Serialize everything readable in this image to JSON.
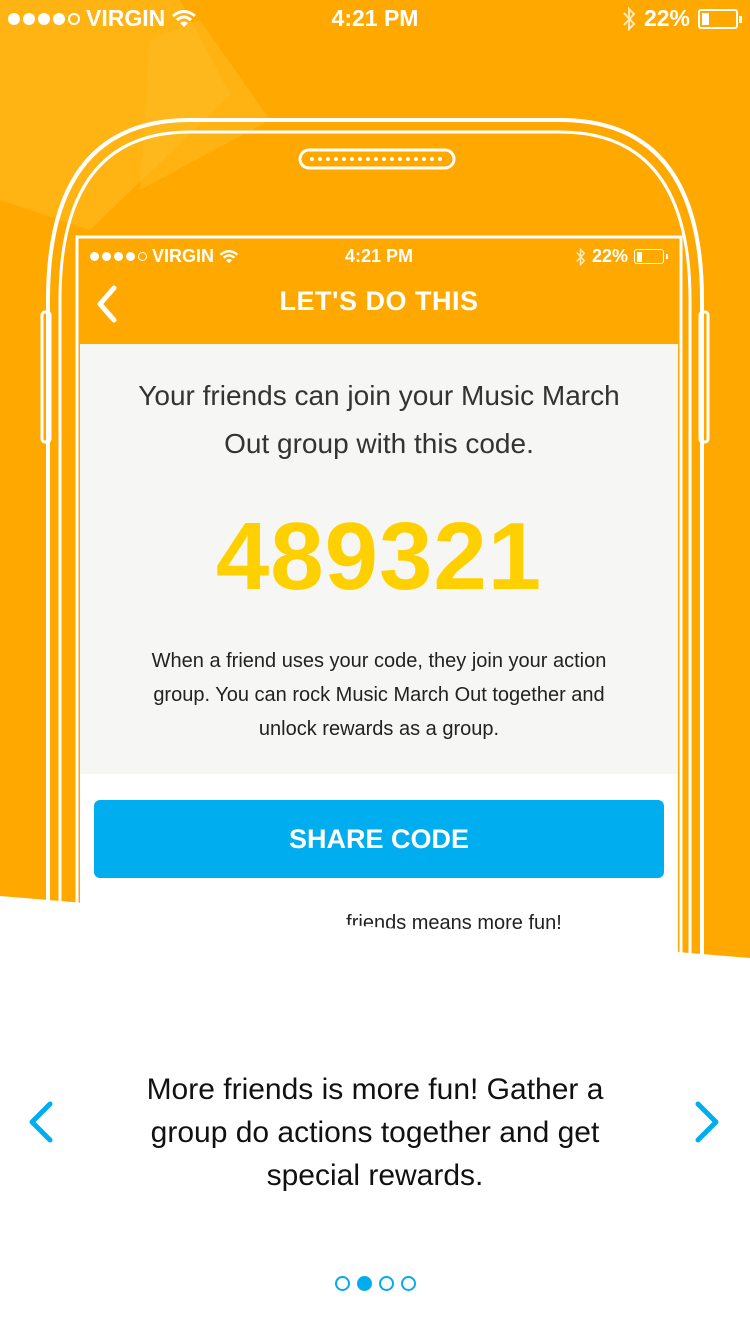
{
  "status_bar": {
    "carrier": "VIRGIN",
    "time": "4:21 PM",
    "battery": "22%"
  },
  "screen": {
    "status_bar": {
      "carrier": "VIRGIN",
      "time": "4:21 PM",
      "battery": "22%"
    },
    "title": "LET'S DO THIS",
    "intro": "Your friends can join your Music March Out group with this code.",
    "code": "489321",
    "explanation": "When a friend uses your code, they join your action group. You can rock Music March Out together and unlock rewards as a group.",
    "share_button": "SHARE CODE",
    "teaser": "friends means more fun!"
  },
  "carousel": {
    "caption": "More friends is more fun! Gather a group do actions together and get special rewards.",
    "page_count": 4,
    "active_page": 2
  },
  "colors": {
    "brand_orange": "#FFA800",
    "code_yellow": "#FFD000",
    "accent_blue": "#00AEEF"
  },
  "icons": [
    "wifi-icon",
    "bluetooth-icon",
    "battery-icon",
    "chevron-left-icon",
    "chevron-right-icon"
  ]
}
